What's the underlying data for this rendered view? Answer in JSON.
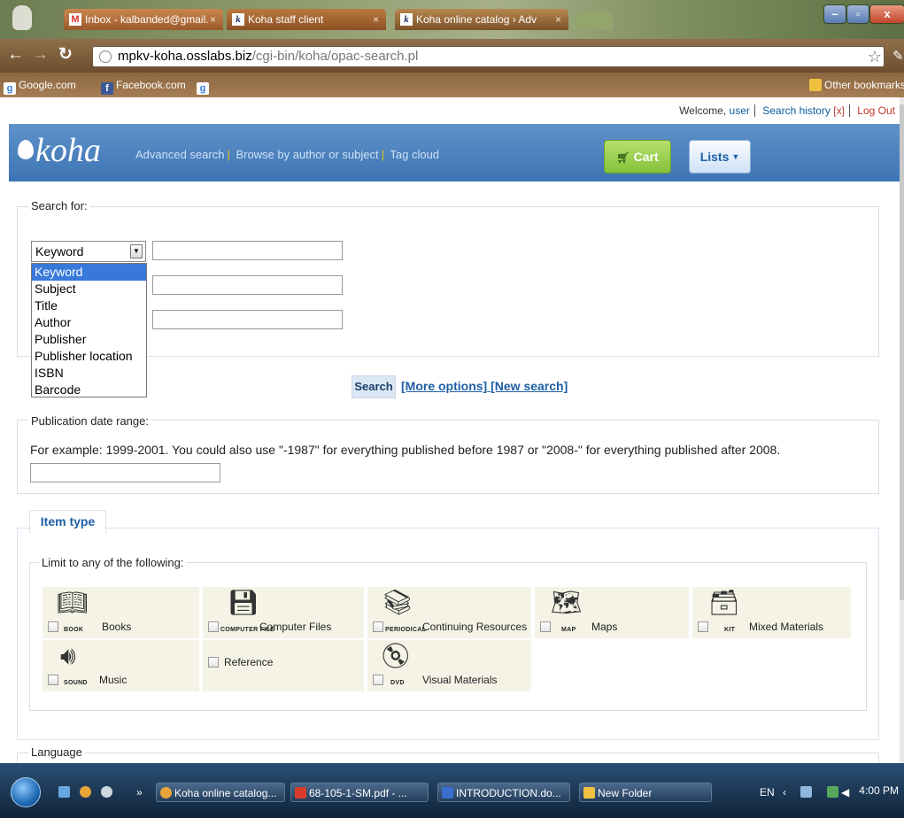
{
  "browser": {
    "tabs": [
      {
        "title": "Inbox - kalbanded@gmail.",
        "favicon": "gmail-icon"
      },
      {
        "title": "Koha staff client",
        "favicon": "koha-icon"
      },
      {
        "title": "Koha online catalog › Adv",
        "favicon": "koha-icon"
      }
    ],
    "url_domain": "mpkv-koha.osslabs.biz",
    "url_path": "/cgi-bin/koha/opac-search.pl",
    "bookmarks": [
      "Google.com",
      "Facebook.com"
    ],
    "other_bookmarks": "Other bookmarks"
  },
  "userbar": {
    "welcome": "Welcome,",
    "user": "user",
    "search_history": "Search history",
    "clear": "[x]",
    "logout": "Log Out"
  },
  "masthead": {
    "logo": "koha",
    "links": [
      "Advanced search",
      "Browse by author or subject",
      "Tag cloud"
    ],
    "cart": "Cart",
    "lists": "Lists"
  },
  "search": {
    "legend": "Search for:",
    "selected_index": "Keyword",
    "options": [
      "Keyword",
      "Subject",
      "Title",
      "Author",
      "Publisher",
      "Publisher location",
      "ISBN",
      "Barcode"
    ],
    "button": "Search",
    "more_options": "[More options]",
    "new_search": "[New search]"
  },
  "pubdate": {
    "legend": "Publication date range:",
    "hint": "For example: 1999-2001. You could also use \"-1987\" for everything published before 1987 or \"2008-\" for everything published after 2008."
  },
  "itemtype": {
    "tab": "Item type",
    "legend": "Limit to any of the following:",
    "items": [
      {
        "tag": "BOOK",
        "label": "Books",
        "icon": "book-icon"
      },
      {
        "tag": "COMPUTER FILE",
        "label": "Computer Files",
        "icon": "floppy-disk-icon"
      },
      {
        "tag": "PERIODICAL",
        "label": "Continuing Resources",
        "icon": "periodical-icon"
      },
      {
        "tag": "MAP",
        "label": "Maps",
        "icon": "map-icon"
      },
      {
        "tag": "KIT",
        "label": "Mixed Materials",
        "icon": "kit-box-icon"
      },
      {
        "tag": "SOUND",
        "label": "Music",
        "icon": "speaker-icon"
      },
      {
        "tag": "",
        "label": "Reference",
        "icon": ""
      },
      {
        "tag": "DVD",
        "label": "Visual Materials",
        "icon": "dvd-icon"
      }
    ]
  },
  "language": {
    "legend": "Language"
  },
  "taskbar": {
    "items": [
      "Koha online catalog...",
      "68-105-1-SM.pdf - ...",
      "INTRODUCTION.do...",
      "New Folder"
    ],
    "lang": "EN",
    "time": "4:00 PM"
  },
  "colors": {
    "masthead": "#3d74b4",
    "cart": "#85c23a",
    "link": "#1f5fa6",
    "dropdown_highlight": "#3879d9"
  }
}
